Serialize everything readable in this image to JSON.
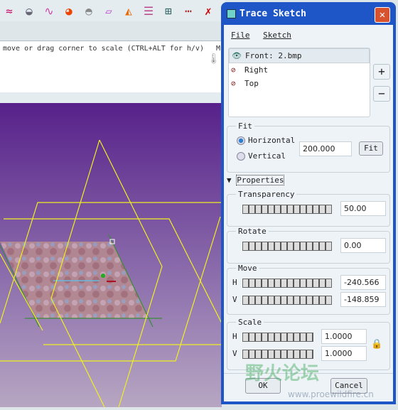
{
  "toolbar": {
    "icons": [
      "sketch-curve-icon",
      "surface-icon",
      "wave-icon",
      "color-map-icon",
      "gray-surface-icon",
      "shape-icon",
      "gradient-icon",
      "section-icon",
      "ruler-save-icon",
      "ruler-hide-icon",
      "delete-curve-icon"
    ]
  },
  "message": {
    "text": "move or drag corner to scale (CTRL+ALT for h/v)",
    "side": "M"
  },
  "dialog": {
    "title": "Trace Sketch",
    "menu": [
      "File",
      "Sketch"
    ],
    "list": [
      {
        "label": "Front: 2.bmp",
        "visible": true,
        "selected": true
      },
      {
        "label": "Right",
        "visible": false
      },
      {
        "label": "Top",
        "visible": false
      }
    ],
    "add_label": "+",
    "remove_label": "−",
    "fit": {
      "legend": "Fit",
      "horizontal": "Horizontal",
      "vertical": "Vertical",
      "selected": "Horizontal",
      "value": "200.000",
      "button": "Fit"
    },
    "properties_label": "Properties",
    "transparency": {
      "legend": "Transparency",
      "value": "50.00"
    },
    "rotate": {
      "legend": "Rotate",
      "value": "0.00"
    },
    "move": {
      "legend": "Move",
      "h_label": "H",
      "h_value": "-240.566",
      "v_label": "V",
      "v_value": "-148.859"
    },
    "scale": {
      "legend": "Scale",
      "h_label": "H",
      "h_value": "1.0000",
      "v_label": "V",
      "v_value": "1.0000"
    },
    "ok": "OK",
    "cancel": "Cancel"
  },
  "watermark": {
    "text": "野火论坛",
    "url": "www.proewildfire.cn"
  },
  "colors": {
    "accent": "#1e56c8",
    "sketch_lines": "#f0f020",
    "viewport_top": "#57218a"
  }
}
